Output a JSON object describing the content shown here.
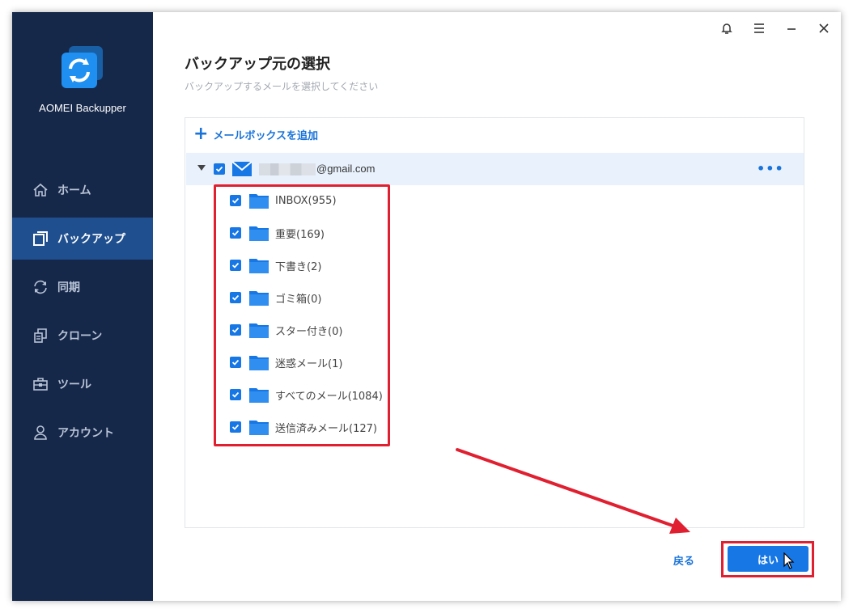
{
  "app": {
    "name": "AOMEI Backupper"
  },
  "sidebar": {
    "items": [
      {
        "label": "ホーム",
        "icon": "home-icon",
        "active": false
      },
      {
        "label": "バックアップ",
        "icon": "backup-icon",
        "active": true
      },
      {
        "label": "同期",
        "icon": "sync-icon",
        "active": false
      },
      {
        "label": "クローン",
        "icon": "clone-icon",
        "active": false
      },
      {
        "label": "ツール",
        "icon": "tools-icon",
        "active": false
      },
      {
        "label": "アカウント",
        "icon": "account-icon",
        "active": false
      }
    ]
  },
  "titlebar": {
    "icons": [
      "bell-icon",
      "menu-icon",
      "minimize-icon",
      "close-icon"
    ]
  },
  "main": {
    "title": "バックアップ元の選択",
    "subtitle": "バックアップするメールを選択してください",
    "add_mailbox_label": "メールボックスを追加",
    "account": {
      "email_suffix": "@gmail.com",
      "checked": true,
      "more_label": "•••"
    },
    "folders": [
      {
        "label": "INBOX(955)",
        "checked": true
      },
      {
        "label": "重要(169)",
        "checked": true
      },
      {
        "label": "下書き(2)",
        "checked": true
      },
      {
        "label": "ゴミ箱(0)",
        "checked": true
      },
      {
        "label": "スター付き(0)",
        "checked": true
      },
      {
        "label": "迷惑メール(1)",
        "checked": true
      },
      {
        "label": "すべてのメール(1084)",
        "checked": true
      },
      {
        "label": "送信済みメール(127)",
        "checked": true
      }
    ]
  },
  "footer": {
    "back_label": "戻る",
    "ok_label": "はい"
  },
  "colors": {
    "sidebar_bg": "#16284a",
    "sidebar_active": "#1f4f8f",
    "accent": "#1677e5",
    "annotation_red": "#e02030"
  }
}
